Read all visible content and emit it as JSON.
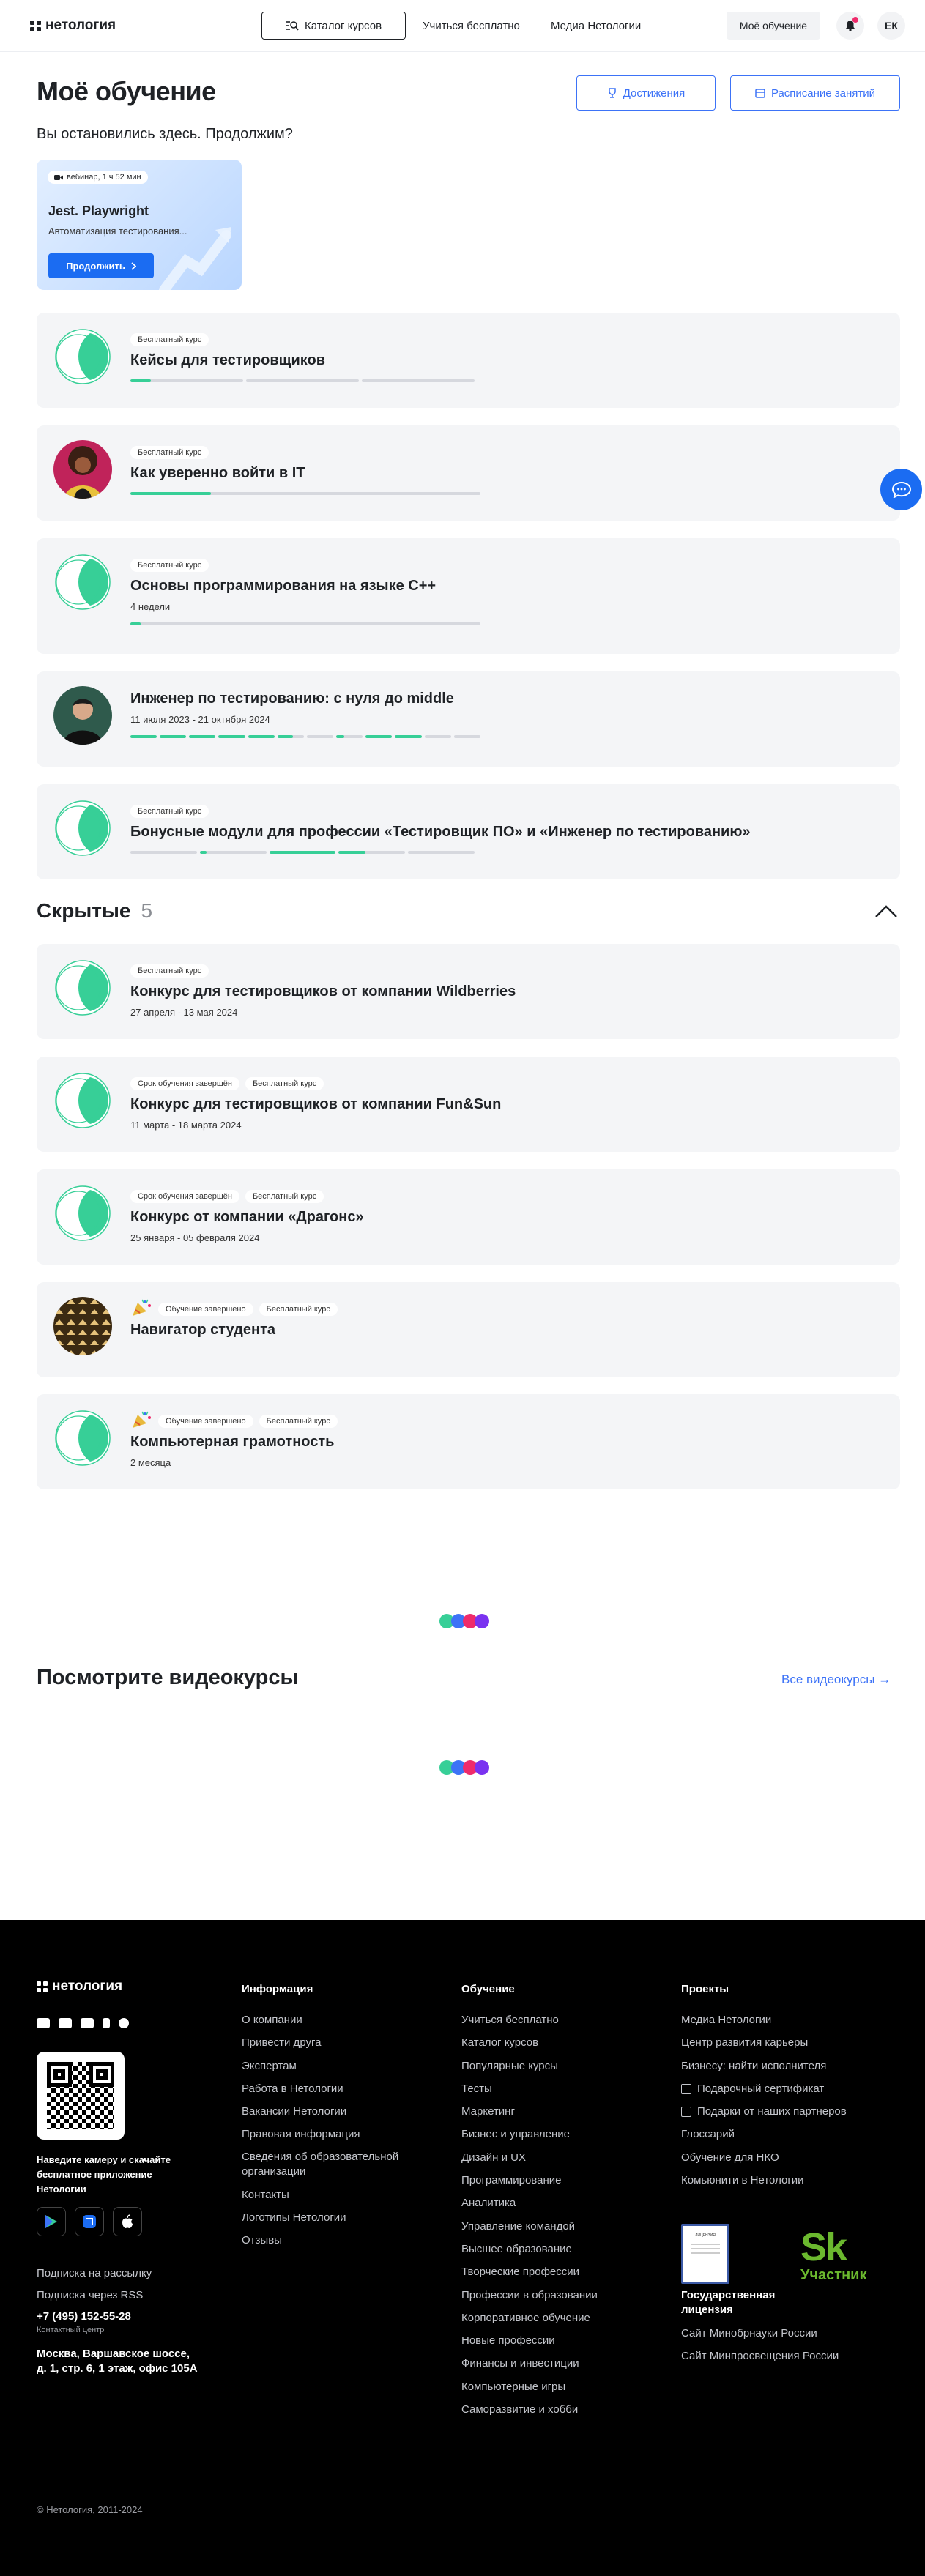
{
  "header": {
    "logo": "нетология",
    "catalog_label": "Каталог курсов",
    "nav": [
      "Учиться бесплатно",
      "Медиа Нетологии"
    ],
    "my_learning": "Моё обучение",
    "avatar_initials": "ЕК"
  },
  "page": {
    "title": "Моё обучение",
    "achievements": "Достижения",
    "schedule": "Расписание занятий",
    "continue_title": "Вы остановились здесь. Продолжим?"
  },
  "resume": {
    "tag": "вебинар, 1 ч 52 мин",
    "title": "Jest. Playwright",
    "subtitle": "Автоматизация тестирования...",
    "button": "Продолжить"
  },
  "courses": [
    {
      "badges": [
        "Бесплатный курс"
      ],
      "title": "Кейсы для тестировщиков",
      "meta": "",
      "thumb": "ring",
      "progress": [
        0.18,
        0,
        0
      ]
    },
    {
      "badges": [
        "Бесплатный курс"
      ],
      "title": "Как уверенно войти в IT",
      "meta": "",
      "thumb": "photo-woman",
      "progress": [
        0.23
      ]
    },
    {
      "badges": [
        "Бесплатный курс"
      ],
      "title": "Основы программирования на языке С++",
      "meta": "4 недели",
      "thumb": "ring",
      "progress": [
        0.03
      ]
    },
    {
      "badges": [],
      "title": "Инженер по тестированию: с нуля до middle",
      "meta": "11 июля 2023 - 21 октября 2024",
      "thumb": "photo-man",
      "progress": [
        1,
        1,
        1,
        1,
        1,
        0.6,
        0,
        0.3,
        1,
        1,
        0,
        0
      ]
    },
    {
      "badges": [
        "Бесплатный курс"
      ],
      "title": "Бонусные модули для профессии «Тестировщик ПО» и «Инженер по тестированию»",
      "meta": "",
      "thumb": "ring",
      "progress": [
        0,
        0.1,
        1,
        0.4,
        0
      ]
    }
  ],
  "hidden": {
    "title": "Скрытые",
    "count": "5",
    "items": [
      {
        "badges": [
          "Бесплатный курс"
        ],
        "title": "Конкурс для тестировщиков от компании Wildberries",
        "meta": "27 апреля - 13 мая 2024",
        "thumb": "ring",
        "party": false
      },
      {
        "badges": [
          "Срок обучения завершён",
          "Бесплатный курс"
        ],
        "title": "Конкурс для тестировщиков от компании Fun&Sun",
        "meta": "11 марта - 18 марта 2024",
        "thumb": "ring",
        "party": false
      },
      {
        "badges": [
          "Срок обучения завершён",
          "Бесплатный курс"
        ],
        "title": "Конкурс от компании «Драгонс»",
        "meta": "25 января - 05 февраля 2024",
        "thumb": "ring",
        "party": false
      },
      {
        "badges": [
          "Обучение завершено",
          "Бесплатный курс"
        ],
        "title": "Навигатор студента",
        "meta": "",
        "thumb": "pattern",
        "party": true
      },
      {
        "badges": [
          "Обучение завершено",
          "Бесплатный курс"
        ],
        "title": "Компьютерная грамотность",
        "meta": "2 месяца",
        "thumb": "ring",
        "party": true
      }
    ]
  },
  "videos": {
    "title": "Посмотрите видеокурсы",
    "all_link": "Все видеокурсы →"
  },
  "footer": {
    "logo": "нетология",
    "scan_text": "Наведите камеру и скачайте бесплатное приложение Нетологии",
    "subscribe": "Подписка на рассылку",
    "rss": "Подписка через RSS",
    "phone": "+7 (495) 152-55-28",
    "phone_sub": "Контактный центр",
    "address": "Москва, Варшавское шоссе, д. 1, стр. 6, 1 этаж, офис 105А",
    "copyright": "© Нетология, 2011-2024",
    "info": {
      "title": "Информация",
      "links": [
        "О компании",
        "Привести друга",
        "Экспертам",
        "Работа в Нетологии",
        "Вакансии Нетологии",
        "Правовая информация",
        "Сведения об образовательной организации",
        "Контакты",
        "Логотипы Нетологии",
        "Отзывы"
      ]
    },
    "learning": {
      "title": "Обучение",
      "links": [
        "Учиться бесплатно",
        "Каталог курсов",
        "Популярные курсы",
        "Тесты",
        "Маркетинг",
        "Бизнес и управление",
        "Дизайн и UX",
        "Программирование",
        "Аналитика",
        "Управление командой",
        "Высшее образование",
        "Творческие профессии",
        "Профессии в образовании",
        "Корпоративное обучение",
        "Новые профессии",
        "Финансы и инвестиции",
        "Компьютерные игры",
        "Саморазвитие и хобби"
      ]
    },
    "projects": {
      "title": "Проекты",
      "links": [
        "Медиа Нетологии",
        "Центр развития карьеры",
        "Бизнесу: найти исполнителя",
        "Подарочный сертификат",
        "Подарки от наших партнеров",
        "Глоссарий",
        "Обучение для НКО",
        "Комьюнити в Нетологии"
      ]
    },
    "license": "Государственная лицензия",
    "license_doc": "ЛИЦЕНЗИЯ",
    "sk_logo": "Sk",
    "sk_label": "Участник",
    "gov1": "Сайт Минобрнауки России",
    "gov2": "Сайт Минпросвещения России"
  },
  "colors": {
    "accent": "#3d73f7",
    "progress": "#37cf97",
    "button": "#1b6cf2",
    "card_bg": "#f4f5f7",
    "loader": [
      "#37cf97",
      "#3d73f7",
      "#ef2b6b",
      "#7a32f0"
    ]
  }
}
